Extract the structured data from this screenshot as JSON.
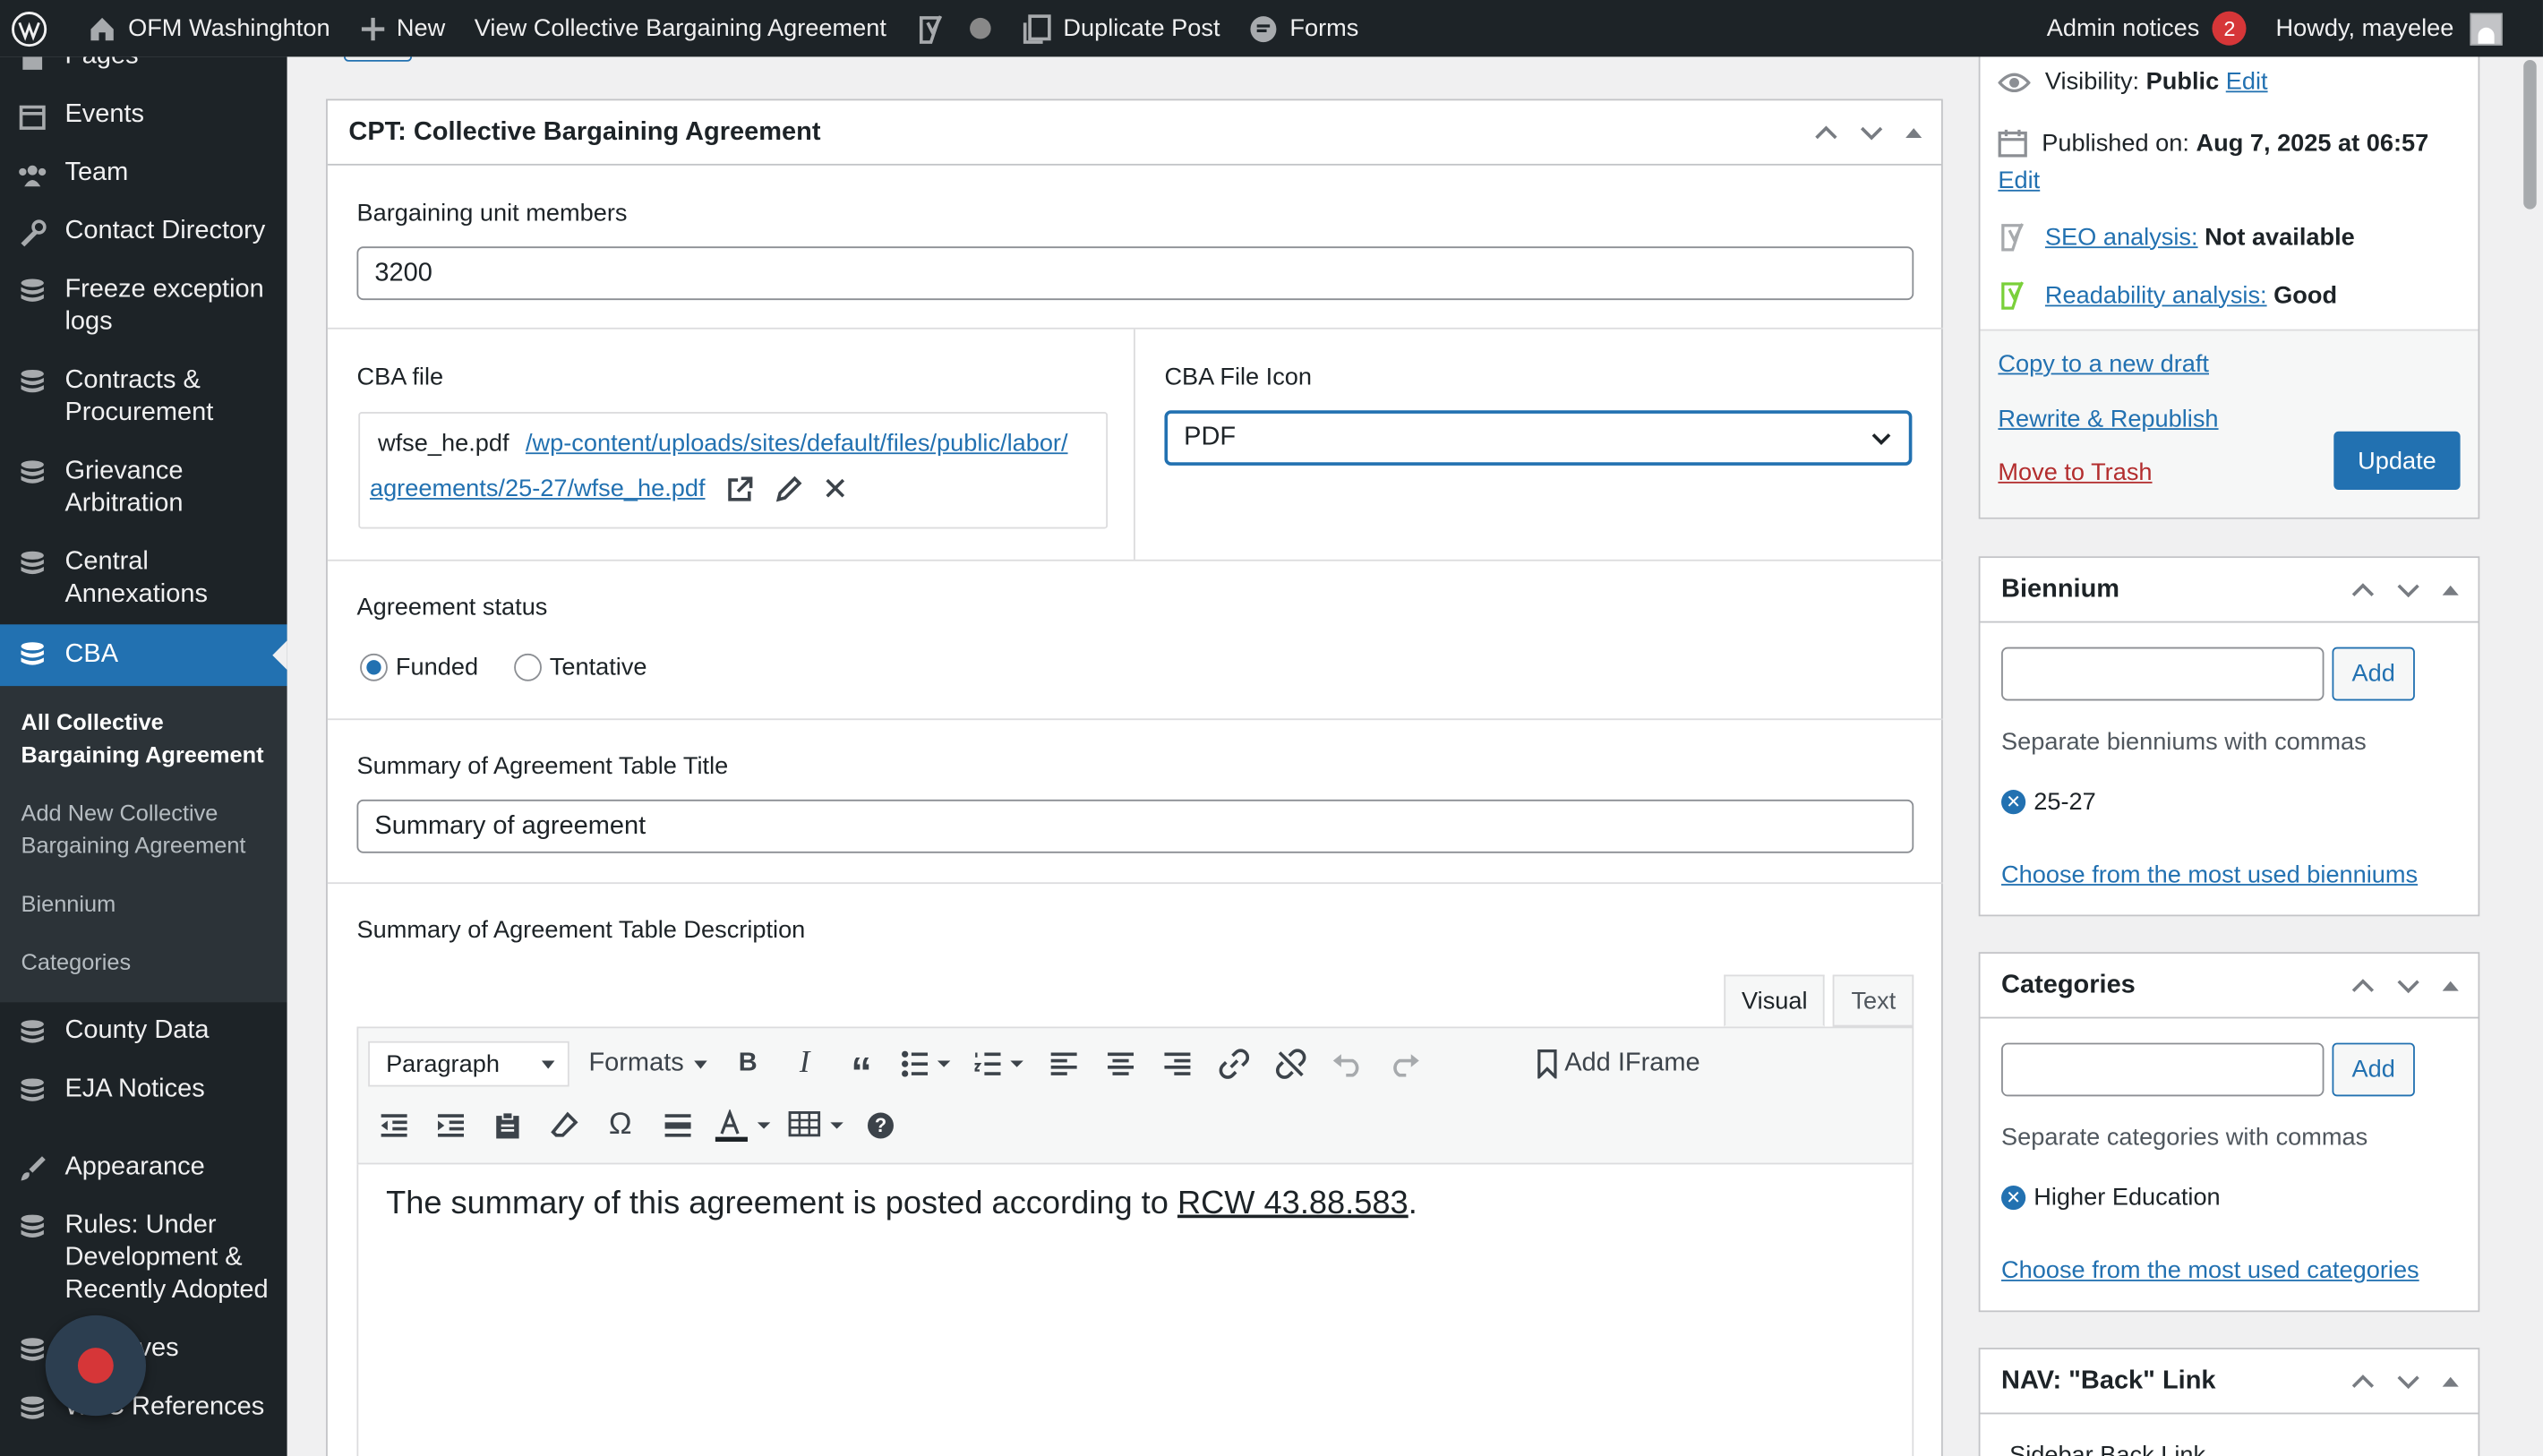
{
  "adminbar": {
    "site_name": "OFM Washinghton",
    "new_label": "New",
    "view_label": "View Collective Bargaining Agreement",
    "duplicate_label": "Duplicate Post",
    "forms_label": "Forms",
    "admin_notices_label": "Admin notices",
    "admin_notices_count": "2",
    "howdy_label": "Howdy, mayelee"
  },
  "sidebar": {
    "items": [
      {
        "label": "Pages",
        "icon": "pages-icon"
      },
      {
        "label": "Events",
        "icon": "calendar-icon"
      },
      {
        "label": "Team",
        "icon": "groups-icon"
      },
      {
        "label": "Contact Directory",
        "icon": "wrench-icon"
      },
      {
        "label": "Freeze exception logs",
        "icon": "database-icon"
      },
      {
        "label": "Contracts & Procurement",
        "icon": "database-icon"
      },
      {
        "label": "Grievance Arbitration",
        "icon": "database-icon"
      },
      {
        "label": "Central Annexations",
        "icon": "database-icon"
      },
      {
        "label": "CBA",
        "icon": "database-icon"
      }
    ],
    "submenu": [
      {
        "label": "All Collective Bargaining Agreement"
      },
      {
        "label": "Add New Collective Bargaining Agreement"
      },
      {
        "label": "Biennium"
      },
      {
        "label": "Categories"
      }
    ],
    "items_after": [
      {
        "label": "County Data",
        "icon": "database-icon"
      },
      {
        "label": "EJA Notices",
        "icon": "database-icon"
      },
      {
        "label": "Appearance",
        "icon": "brush-icon"
      },
      {
        "label": "Rules: Under Development & Recently Adopted",
        "icon": "database-icon"
      },
      {
        "label": "Directives",
        "icon": "database-icon"
      },
      {
        "label": "WAC References",
        "icon": "database-icon"
      }
    ]
  },
  "cpt_box": {
    "title": "CPT: Collective Bargaining Agreement",
    "members_label": "Bargaining unit members",
    "members_value": "3200",
    "cba_file_label": "CBA file",
    "file_name": "wfse_he.pdf",
    "file_path_line1": "/wp-content/uploads/sites/default/files/public/labor/",
    "file_path_line2": "agreements/25-27/wfse_he.pdf",
    "cba_icon_label": "CBA File Icon",
    "cba_icon_value": "PDF",
    "status_label": "Agreement status",
    "status_options": [
      "Funded",
      "Tentative"
    ],
    "status_selected": "Funded",
    "table_title_label": "Summary of Agreement Table Title",
    "table_title_value": "Summary of agreement",
    "table_desc_label": "Summary of Agreement Table Description",
    "editor_tabs": [
      "Visual",
      "Text"
    ],
    "format_select": "Paragraph",
    "formats_label": "Formats",
    "add_iframe_label": "Add IFrame",
    "editor_text_before": "The summary of this agreement is posted according to ",
    "editor_link": "RCW 43.88.583",
    "editor_text_after": "."
  },
  "publish_box": {
    "visibility_label": "Visibility:",
    "visibility_value": "Public",
    "edit_label": "Edit",
    "published_label": "Published on:",
    "published_value": "Aug 7, 2025 at 06:57",
    "seo_label": "SEO analysis:",
    "seo_value": "Not available",
    "readability_label": "Readability analysis:",
    "readability_value": "Good",
    "copy_draft": "Copy to a new draft",
    "rewrite": "Rewrite & Republish",
    "trash": "Move to Trash",
    "update": "Update"
  },
  "biennium_box": {
    "title": "Biennium",
    "add_label": "Add",
    "hint": "Separate bienniums with commas",
    "tag": "25-27",
    "choose_link": "Choose from the most used bienniums"
  },
  "categories_box": {
    "title": "Categories",
    "add_label": "Add",
    "hint": "Separate categories with commas",
    "tag": "Higher Education",
    "choose_link": "Choose from the most used categories"
  },
  "nav_box": {
    "title": "NAV: \"Back\" Link",
    "field_label": "Sidebar Back Link"
  },
  "colors": {
    "adminbar": "#1d2327",
    "accent": "#2271b1",
    "trash": "#b32d2e",
    "yoast_good": "#7ad03a"
  }
}
